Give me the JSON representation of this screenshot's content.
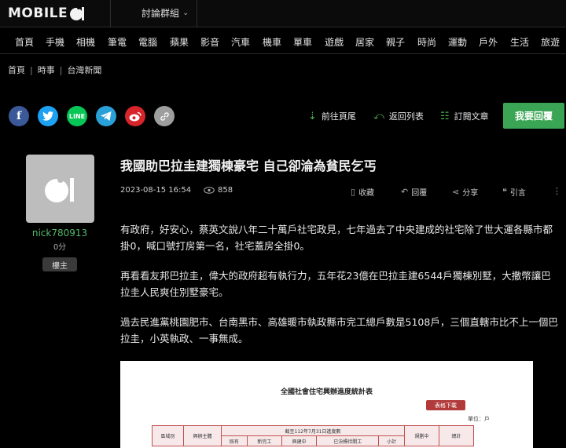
{
  "header": {
    "logo_text": "MOBILE",
    "forum_menu_label": "討論群組"
  },
  "nav": {
    "items": [
      "首頁",
      "手機",
      "相機",
      "筆電",
      "電腦",
      "蘋果",
      "影音",
      "汽車",
      "機車",
      "單車",
      "遊戲",
      "居家",
      "親子",
      "時尚",
      "運動",
      "戶外",
      "生活",
      "旅遊"
    ]
  },
  "breadcrumb": [
    "首頁",
    "時事",
    "台灣新聞"
  ],
  "share": {
    "line_label": "LINE"
  },
  "actions": {
    "go_last": "前往頁尾",
    "back_list": "返回列表",
    "subscribe": "訂閱文章",
    "reply_button": "我要回覆"
  },
  "author": {
    "name": "nick780913",
    "score": "0分",
    "badge": "樓主"
  },
  "post": {
    "title": "我國助巴拉圭建獨棟豪宅 自己卻淪為貧民乞丐",
    "date": "2023-08-15 16:54",
    "views": "858",
    "collect": "收藏",
    "reply": "回覆",
    "share": "分享",
    "quote": "引言",
    "paragraphs": [
      "有政府，好安心，蔡英文說八年二十萬戶社宅政見，七年過去了中央建成的社宅除了世大運各縣市都掛0，喊口號打房第一名，社宅蓋房全掛0。",
      "再看看友邦巴拉圭，偉大的政府超有執行力，五年花23億在巴拉圭建6544戶獨棟別墅，大撒幣讓巴拉圭人民爽住別墅豪宅。",
      "過去民進黨桃園肥市、台南黑市、高雄暖市執政縣市完工總戶數是5108戶，三個直轄市比不上一個巴拉圭，小英執政、一事無成。"
    ]
  },
  "embed": {
    "title": "全國社會住宅興辦進度統計表",
    "download": "表格下載",
    "unit": "單位：戶",
    "header_row1": [
      "區域別",
      "興辦主體",
      "截至112年7月31日進度數",
      "",
      "",
      "",
      "規劃中",
      "總計"
    ],
    "header_row2": [
      "",
      "",
      "既有",
      "新完工",
      "興建中",
      "已決標待開工",
      "小計",
      "",
      ""
    ]
  },
  "colors": {
    "accent_green": "#3aa655",
    "author_green": "#55b96a",
    "facebook": "#3b5998",
    "twitter": "#1da1f2",
    "line": "#06c755",
    "telegram": "#2aa0d8",
    "weibo": "#d8242b",
    "link": "#9e9e9e"
  }
}
